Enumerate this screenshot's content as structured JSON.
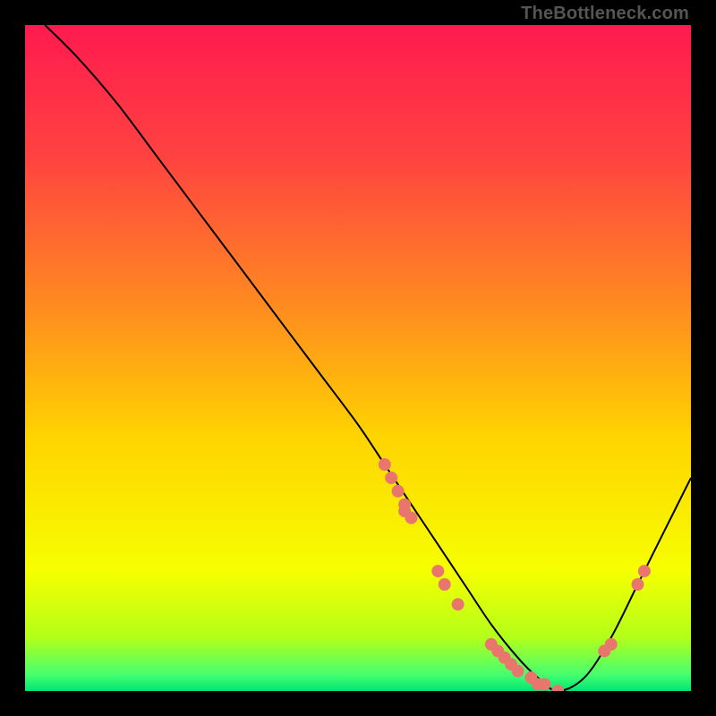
{
  "attribution": "TheBottleneck.com",
  "chart_data": {
    "type": "line",
    "title": "",
    "xlabel": "",
    "ylabel": "",
    "xlim": [
      0,
      100
    ],
    "ylim": [
      0,
      100
    ],
    "grid": false,
    "legend": false,
    "gradient_stops": [
      {
        "offset": 0.0,
        "color": "#ff1a4f"
      },
      {
        "offset": 0.2,
        "color": "#ff4340"
      },
      {
        "offset": 0.42,
        "color": "#ff8a20"
      },
      {
        "offset": 0.62,
        "color": "#ffd400"
      },
      {
        "offset": 0.82,
        "color": "#f6ff00"
      },
      {
        "offset": 0.92,
        "color": "#b3ff1a"
      },
      {
        "offset": 0.975,
        "color": "#47ff6e"
      },
      {
        "offset": 1.0,
        "color": "#00e676"
      }
    ],
    "series": [
      {
        "name": "bottleneck-curve",
        "x": [
          3,
          8,
          14,
          20,
          26,
          32,
          38,
          44,
          50,
          54,
          58,
          62,
          66,
          70,
          74,
          77,
          80,
          84,
          88,
          92,
          96,
          100
        ],
        "y": [
          100,
          95,
          88,
          80,
          72,
          64,
          56,
          48,
          40,
          34,
          28,
          22,
          16,
          10,
          5,
          2,
          0,
          2,
          8,
          16,
          24,
          32
        ]
      }
    ],
    "markers": {
      "name": "highlighted-points",
      "x": [
        54,
        55,
        56,
        57,
        57,
        58,
        62,
        63,
        65,
        70,
        71,
        72,
        73,
        74,
        76,
        77,
        78,
        80,
        87,
        88,
        92,
        93
      ],
      "y": [
        34,
        32,
        30,
        28,
        27,
        26,
        18,
        16,
        13,
        7,
        6,
        5,
        4,
        3,
        2,
        1,
        1,
        0,
        6,
        7,
        16,
        18
      ]
    }
  }
}
